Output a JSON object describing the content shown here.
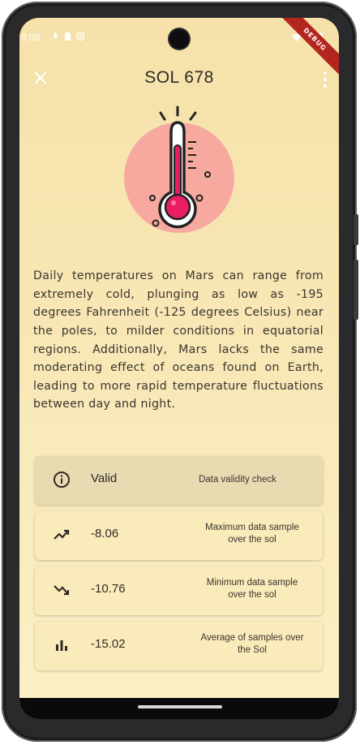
{
  "status_bar": {
    "time": "9:08",
    "debug_label": "DEBUG"
  },
  "app_bar": {
    "title": "SOL 678",
    "close_icon": "close-icon",
    "more_icon": "more-vert-icon"
  },
  "hero": {
    "icon": "thermometer-icon",
    "colors": {
      "circle": "#f7a9a0",
      "bulb": "#e81d62"
    }
  },
  "description": "Daily temperatures on Mars can range from extremely cold, plunging as low as -195 degrees Fahrenheit (-125 degrees Celsius) near the poles, to milder conditions in equatorial regions. Additionally, Mars lacks the same moderating effect of oceans found on Earth, leading to more rapid temperature fluctuations between day and night.",
  "stats": [
    {
      "icon": "info-icon",
      "value": "Valid",
      "label": "Data validity check"
    },
    {
      "icon": "trending-up-icon",
      "value": "-8.06",
      "label": "Maximum data sample over the sol"
    },
    {
      "icon": "trending-down-icon",
      "value": "-10.76",
      "label": "Minimum data sample over the sol"
    },
    {
      "icon": "bar-chart-icon",
      "value": "-15.02",
      "label": "Average of samples over the Sol"
    }
  ]
}
